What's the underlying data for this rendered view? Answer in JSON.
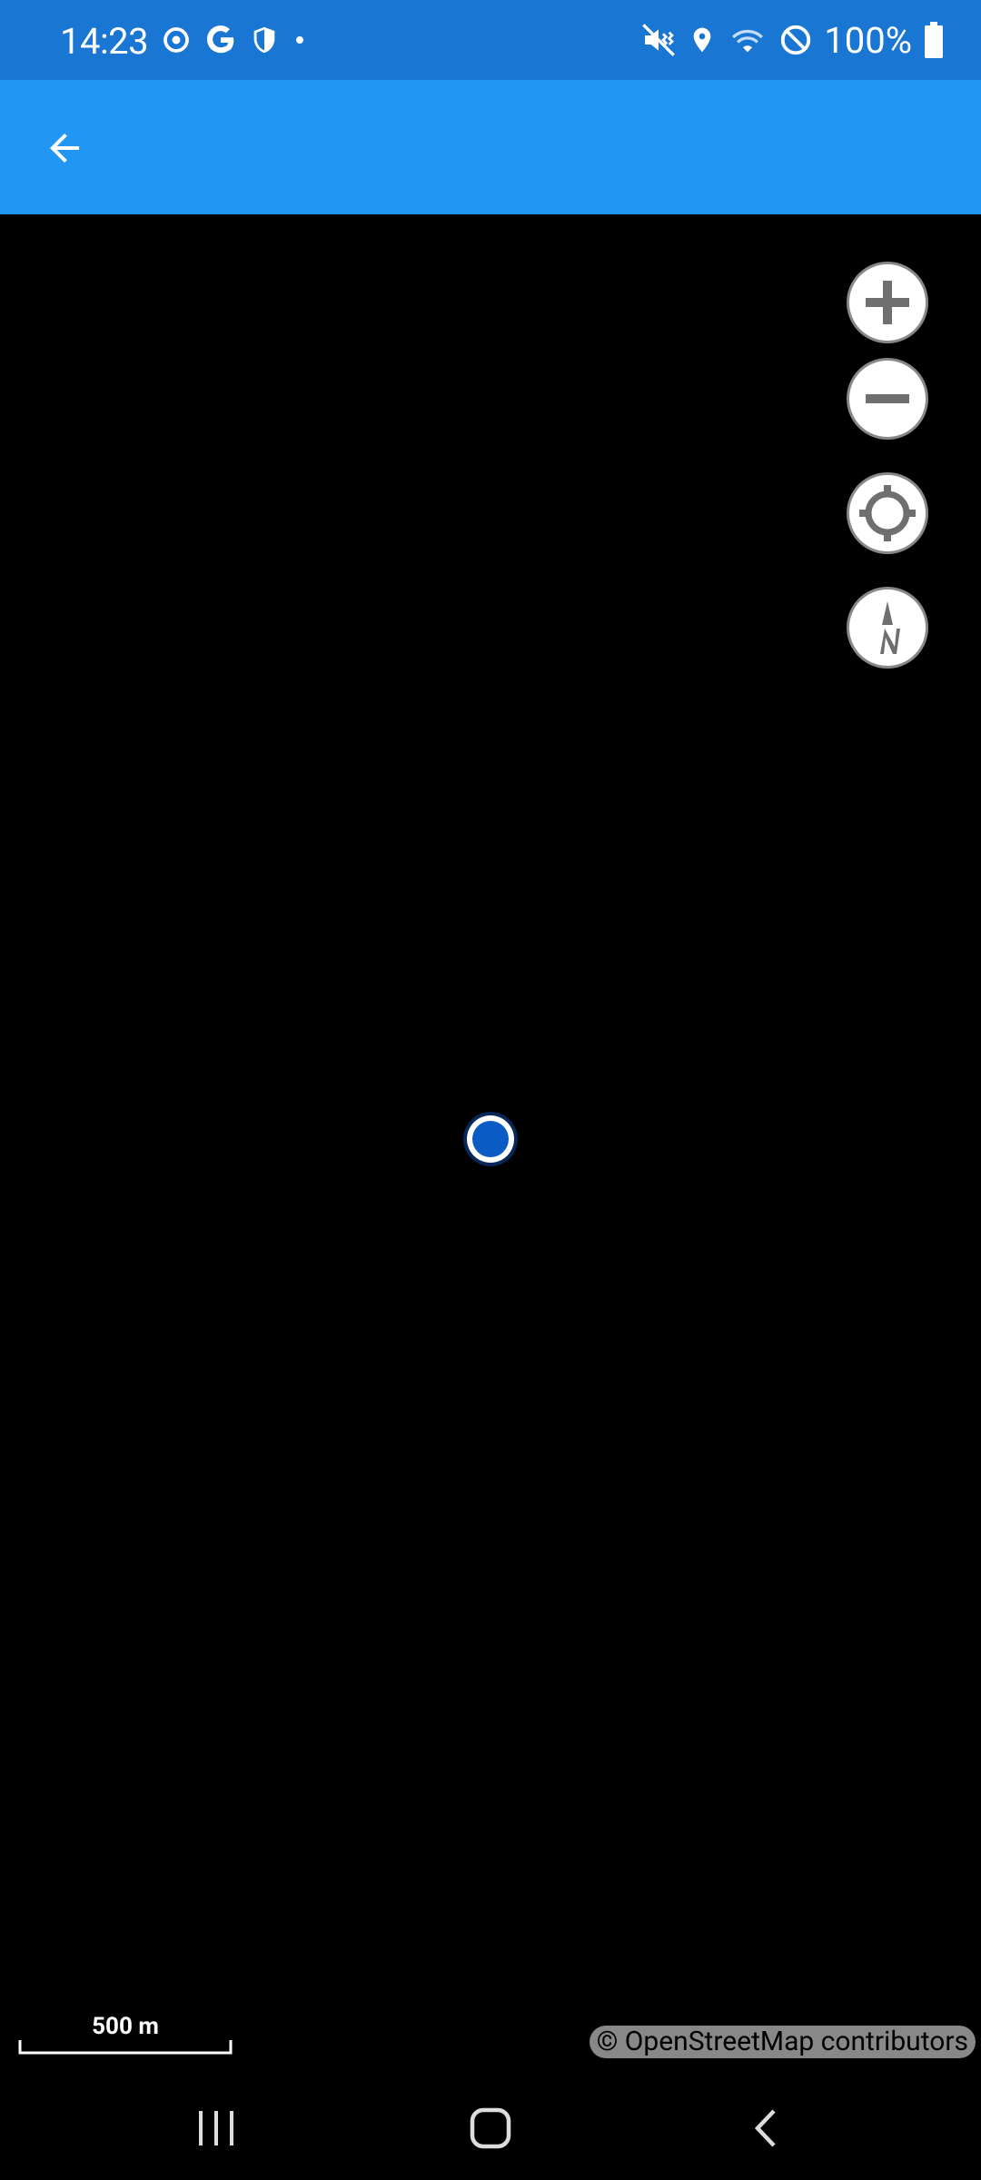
{
  "status_bar": {
    "time": "14:23",
    "battery_text": "100%",
    "left_icons": [
      "sync-icon",
      "google-icon",
      "shield-icon",
      "dot-icon"
    ],
    "right_icons": [
      "mute-vibrate-icon",
      "location-icon",
      "wifi-icon",
      "do-not-disturb-icon",
      "battery-icon"
    ]
  },
  "app_bar": {
    "back_icon": "arrow-back-icon"
  },
  "map": {
    "controls": [
      "zoom-in",
      "zoom-out",
      "locate",
      "compass"
    ],
    "scale_label": "500 m",
    "attribution": "© OpenStreetMap contributors"
  },
  "nav_bar": {
    "buttons": [
      "recents",
      "home",
      "back"
    ]
  },
  "colors": {
    "status_bar": "#1976d2",
    "app_bar": "#2196f3",
    "location_dot": "#0a5bc4"
  }
}
